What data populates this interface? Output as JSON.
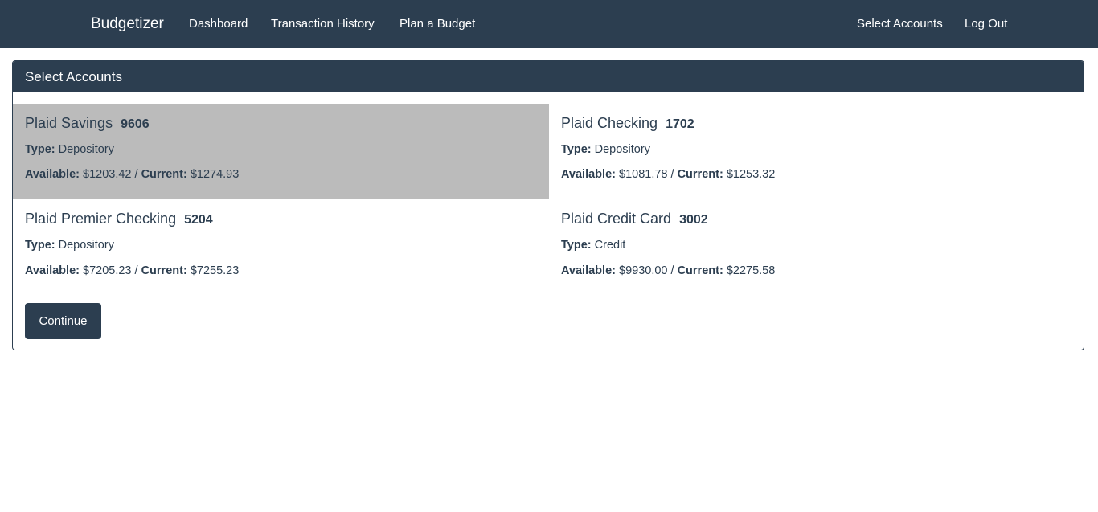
{
  "navbar": {
    "brand": "Budgetizer",
    "left_links": [
      "Dashboard",
      "Transaction History",
      "Plan a Budget"
    ],
    "right_links": [
      "Select Accounts",
      "Log Out"
    ]
  },
  "panel": {
    "heading": "Select Accounts",
    "labels": {
      "type": "Type:",
      "available": "Available:",
      "current": "Current:",
      "separator": "/"
    },
    "accounts": [
      {
        "name": "Plaid Savings",
        "mask": "9606",
        "type": "Depository",
        "available": "$1203.42",
        "current": "$1274.93",
        "selected": true
      },
      {
        "name": "Plaid Checking",
        "mask": "1702",
        "type": "Depository",
        "available": "$1081.78",
        "current": "$1253.32",
        "selected": false
      },
      {
        "name": "Plaid Premier Checking",
        "mask": "5204",
        "type": "Depository",
        "available": "$7205.23",
        "current": "$7255.23",
        "selected": false
      },
      {
        "name": "Plaid Credit Card",
        "mask": "3002",
        "type": "Credit",
        "available": "$9930.00",
        "current": "$2275.58",
        "selected": false
      }
    ],
    "continue_label": "Continue"
  },
  "colors": {
    "primary": "#2c3e50",
    "selected_bg": "#bbbbbb",
    "text": "#2c3e50"
  }
}
